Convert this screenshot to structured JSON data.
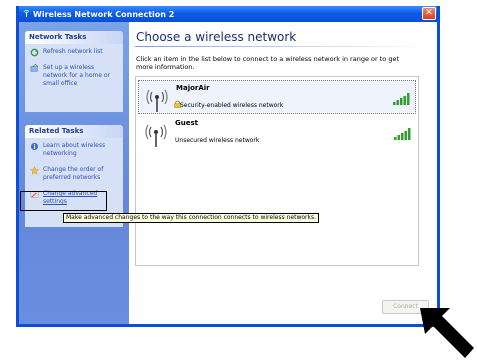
{
  "window": {
    "title": "Wireless Network Connection 2",
    "close_label": "✕"
  },
  "left_pane": {
    "network_tasks": {
      "heading": "Network Tasks",
      "items": [
        {
          "label": "Refresh network list",
          "icon": "refresh-icon"
        },
        {
          "label": "Set up a wireless network for a home or small office",
          "icon": "setup-wizard-icon"
        }
      ]
    },
    "related_tasks": {
      "heading": "Related Tasks",
      "items": [
        {
          "label": "Learn about wireless networking",
          "icon": "info-icon"
        },
        {
          "label": "Change the order of preferred networks",
          "icon": "star-icon"
        },
        {
          "label": "Change advanced settings",
          "icon": "settings-icon"
        }
      ]
    }
  },
  "main": {
    "title": "Choose a wireless network",
    "instructions": "Click an item in the list below to connect to a wireless network in range or to get more information.",
    "networks": [
      {
        "name": "MajorAir",
        "status": "Security-enabled wireless network",
        "secured": true
      },
      {
        "name": "Guest",
        "status": "Unsecured wireless network",
        "secured": false
      }
    ],
    "connect_label": "Connect"
  },
  "tooltip": "Make advanced changes to the way this connection connects to wireless networks."
}
